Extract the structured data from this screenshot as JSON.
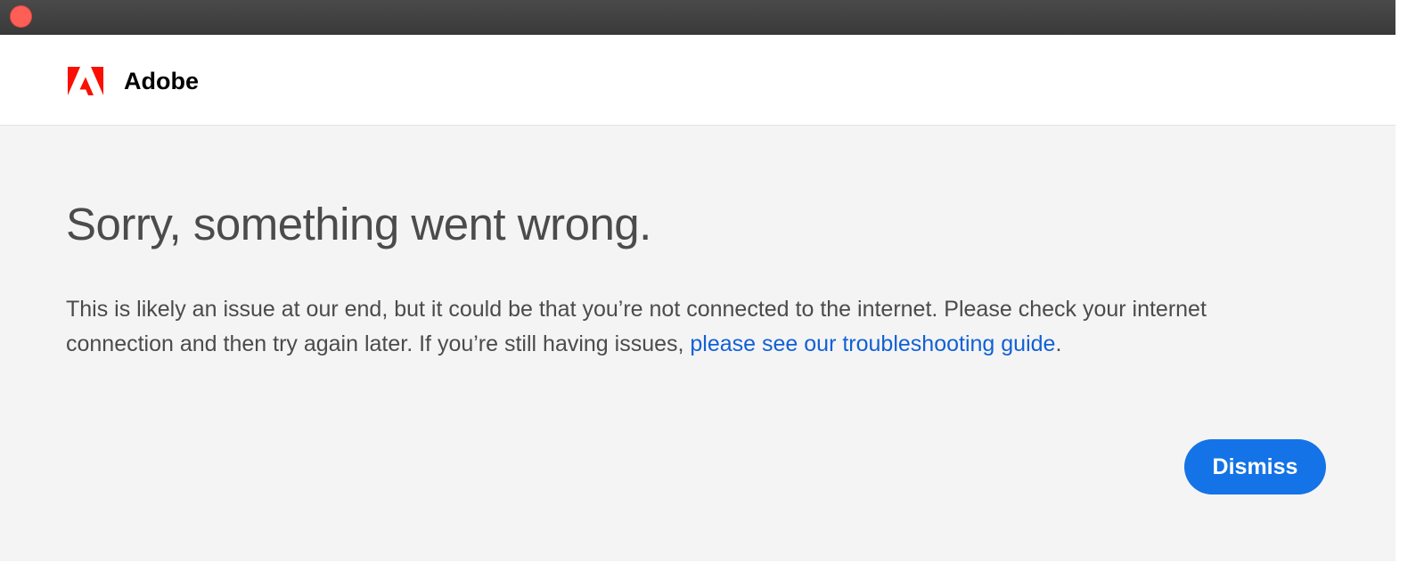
{
  "window": {
    "close_icon": "close-icon"
  },
  "header": {
    "logo_icon": "adobe-logo-icon",
    "brand": "Adobe",
    "brand_color": "#fa0f00"
  },
  "error": {
    "title": "Sorry, something went wrong.",
    "message_before_link": "This is likely an issue at our end, but it could be that you’re not connected to the internet. Please check your internet connection and then try again later. If you’re still having issues, ",
    "link_text": "please see our troubleshooting guide",
    "message_after_link": "."
  },
  "actions": {
    "dismiss_label": "Dismiss",
    "accent_color": "#1473e6"
  },
  "colors": {
    "background": "#f4f4f4",
    "text": "#4b4b4b",
    "link": "#1160d6",
    "titlebar": "#3a3a3a"
  }
}
